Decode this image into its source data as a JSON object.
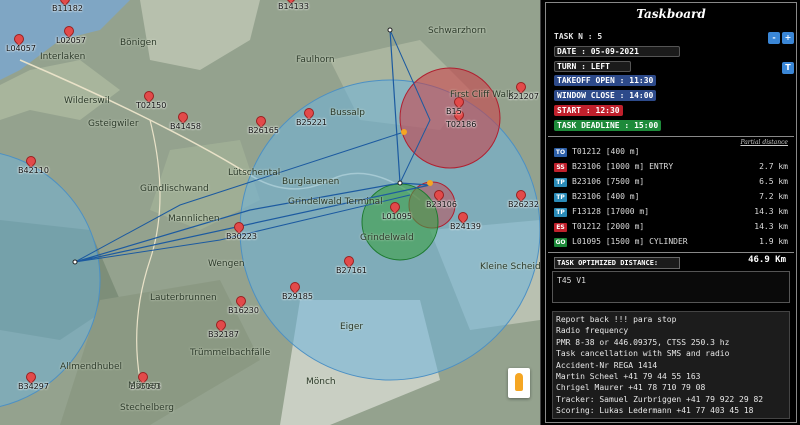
{
  "map": {
    "waypoints": [
      "B11182",
      "L02057",
      "B14133",
      "L04057",
      "B25221",
      "B26165",
      "B41458",
      "T02150",
      "B42110",
      "T02186",
      "B15",
      "B21207",
      "B30223",
      "L01095",
      "B23106",
      "B24139",
      "B26232",
      "B27161",
      "B29185",
      "B16230",
      "B32187",
      "B34297",
      "B35163"
    ],
    "places": [
      "Interlaken",
      "Wilderswil",
      "Gsteigwiler",
      "Gündlischwand",
      "Mannlichen",
      "Grindelwald Terminal",
      "Grindelwald",
      "Lauterbrunnen",
      "Wengen",
      "Trümmelbachfälle",
      "Allmendhubel",
      "Mürren",
      "Stechelberg",
      "Schwarzhorn",
      "Faulhorn",
      "First Cliff Walk",
      "Bussalp",
      "Eiger",
      "Mönch",
      "Kleine Scheidegg",
      "Bönigen",
      "Lütschental",
      "Burglauenen"
    ]
  },
  "panel": {
    "title": "Taskboard",
    "task_n": "TASK N : 5",
    "date": "DATE : 05-09-2021",
    "turn": "TURN : LEFT",
    "takeoff": "TAKEOFF OPEN : 11:30",
    "window_close": "WINDOW CLOSE : 14:00",
    "start": "START : 12:30",
    "deadline": "TASK DEADLINE : 15:00",
    "partial_label": "Partial distance",
    "minus": "-",
    "plus": "+",
    "t_button": "T",
    "turnpoints": [
      {
        "type": "TO",
        "name": "T01212 [400 m]",
        "dist": ""
      },
      {
        "type": "SS",
        "name": "B23106 [1000 m] ENTRY",
        "dist": "2.7 km"
      },
      {
        "type": "TP",
        "name": "B23106 [7500 m]",
        "dist": "6.5 km"
      },
      {
        "type": "TP",
        "name": "B23106 [400 m]",
        "dist": "7.2 km"
      },
      {
        "type": "TP",
        "name": "F13128 [17000 m]",
        "dist": "14.3 km"
      },
      {
        "type": "ES",
        "name": "T01212 [2000 m]",
        "dist": "14.3 km"
      },
      {
        "type": "GO",
        "name": "L01095 [1500 m] CYLINDER",
        "dist": "1.9 km"
      }
    ],
    "optimized_label": "TASK OPTIMIZED DISTANCE:",
    "optimized_value": "46.9 Km",
    "task_name": "T45 V1",
    "notes": [
      "Report back !!! para stop",
      "Radio frequency",
      "PMR 8-38 or 446.09375, CTSS 250.3 hz",
      "Task cancellation with SMS and radio",
      "Accident-Nr REGA 1414",
      "Martin Scheel +41 79 44 55 163",
      "Chrigel Maurer +41 78 710 79 08",
      "Tracker: Samuel Zurbriggen +41 79 922 29 82",
      "Scoring: Lukas Ledermann +41 77 403 45 18"
    ]
  },
  "colors": {
    "TO": "#2d5fa8",
    "SS": "#c0202c",
    "TP": "#2a8bb8",
    "ES": "#c0202c",
    "GO": "#1d8a3a"
  }
}
